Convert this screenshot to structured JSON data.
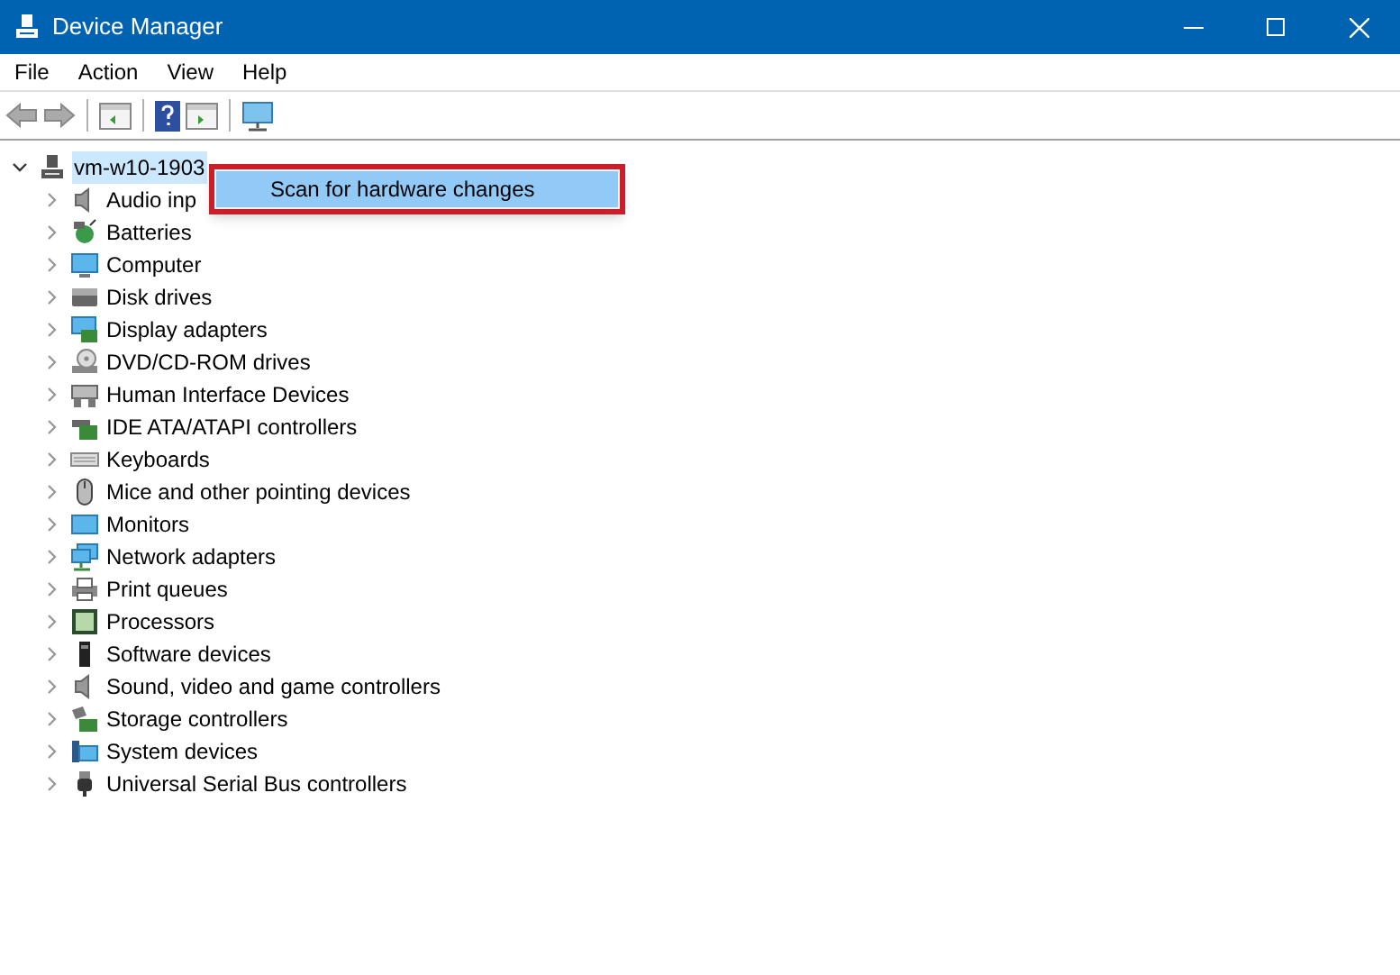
{
  "window": {
    "title": "Device Manager"
  },
  "menu_bar": [
    "File",
    "Action",
    "View",
    "Help"
  ],
  "tree": {
    "label": "vm-w10-1903",
    "expanded": true,
    "selected": true,
    "children": [
      {
        "label": "Audio inp",
        "expanded": false,
        "selected": false
      },
      {
        "label": "Batteries",
        "expanded": false,
        "selected": false
      },
      {
        "label": "Computer",
        "expanded": false,
        "selected": false
      },
      {
        "label": "Disk drives",
        "expanded": false,
        "selected": false
      },
      {
        "label": "Display adapters",
        "expanded": false,
        "selected": false
      },
      {
        "label": "DVD/CD-ROM drives",
        "expanded": false,
        "selected": false
      },
      {
        "label": "Human Interface Devices",
        "expanded": false,
        "selected": false
      },
      {
        "label": "IDE ATA/ATAPI controllers",
        "expanded": false,
        "selected": false
      },
      {
        "label": "Keyboards",
        "expanded": false,
        "selected": false
      },
      {
        "label": "Mice and other pointing devices",
        "expanded": false,
        "selected": false
      },
      {
        "label": "Monitors",
        "expanded": false,
        "selected": false
      },
      {
        "label": "Network adapters",
        "expanded": false,
        "selected": false
      },
      {
        "label": "Print queues",
        "expanded": false,
        "selected": false
      },
      {
        "label": "Processors",
        "expanded": false,
        "selected": false
      },
      {
        "label": "Software devices",
        "expanded": false,
        "selected": false
      },
      {
        "label": "Sound, video and game controllers",
        "expanded": false,
        "selected": false
      },
      {
        "label": "Storage controllers",
        "expanded": false,
        "selected": false
      },
      {
        "label": "System devices",
        "expanded": false,
        "selected": false
      },
      {
        "label": "Universal Serial Bus controllers",
        "expanded": false,
        "selected": false
      }
    ]
  },
  "context_menu": {
    "items": [
      {
        "label": "Scan for hardware changes",
        "selected": true
      }
    ]
  }
}
